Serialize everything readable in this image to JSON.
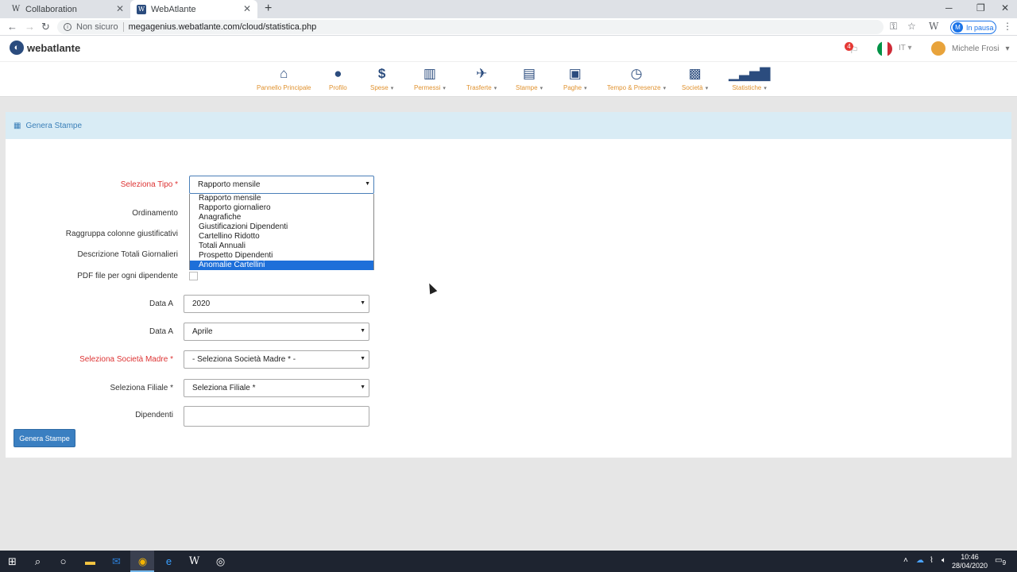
{
  "browser": {
    "tabs": [
      {
        "title": "Collaboration",
        "icon": "W"
      },
      {
        "title": "WebAtlante",
        "icon": "W"
      }
    ],
    "security_label": "Non sicuro",
    "url": "megagenius.webatlante.com/cloud/statistica.php",
    "profile_initial": "M",
    "profile_status": "In pausa"
  },
  "header": {
    "brand": "webatlante",
    "notification_count": "4",
    "language": "IT",
    "user_name": "Michele Frosi"
  },
  "nav": {
    "items": [
      {
        "label": "Pannello Principale",
        "icon": "home-icon"
      },
      {
        "label": "Profilo",
        "icon": "user-icon"
      },
      {
        "label": "Spese",
        "icon": "dollar-icon"
      },
      {
        "label": "Permessi",
        "icon": "bar-chart-icon"
      },
      {
        "label": "Trasferte",
        "icon": "airplane-icon"
      },
      {
        "label": "Stampe",
        "icon": "document-icon"
      },
      {
        "label": "Paghe",
        "icon": "money-icon"
      },
      {
        "label": "Tempo & Presenze",
        "icon": "clock-icon"
      },
      {
        "label": "Società",
        "icon": "briefcase-icon"
      },
      {
        "label": "Statistiche",
        "icon": "signal-icon"
      }
    ]
  },
  "panel": {
    "title": "Genera Stampe"
  },
  "form": {
    "tipo_label": "Seleziona Tipo *",
    "tipo_value": "Rapporto mensile",
    "tipo_options": [
      "Rapporto mensile",
      "Rapporto giornaliero",
      "Anagrafiche",
      "Giustificazioni Dipendenti",
      "Cartellino Ridotto",
      "Totali Annuali",
      "Prospetto Dipendenti",
      "Anomalie Cartellini"
    ],
    "ordinamento_label": "Ordinamento",
    "raggruppa_label": "Raggruppa colonne giustificativi",
    "descrizione_label": "Descrizione Totali Giornalieri",
    "pdf_label": "PDF file per ogni dipendente",
    "anno_label": "Data A",
    "anno_value": "2020",
    "mese_label": "Data A",
    "mese_value": "Aprile",
    "societa_label": "Seleziona Società Madre *",
    "societa_value": "- Seleziona Società Madre * -",
    "filiale_label": "Seleziona Filiale *",
    "filiale_value": "Seleziona Filiale *",
    "dipendenti_label": "Dipendenti",
    "dipendenti_value": "",
    "submit_label": "Genera Stampe"
  },
  "taskbar": {
    "time": "10:46",
    "date": "28/04/2020",
    "notifications": "9"
  }
}
